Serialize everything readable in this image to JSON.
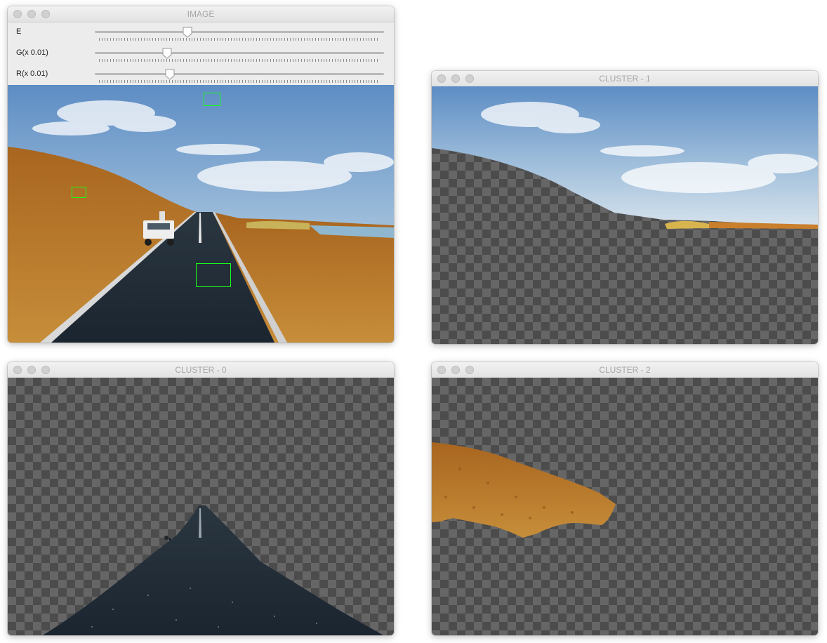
{
  "windows": {
    "image": {
      "title": "IMAGE",
      "trackbars": [
        {
          "label": "E",
          "value": 0.32
        },
        {
          "label": "G(x 0.01)",
          "value": 0.25
        },
        {
          "label": "R(x 0.01)",
          "value": 0.26
        }
      ]
    },
    "cluster1": {
      "title": "CLUSTER - 1"
    },
    "cluster0": {
      "title": "CLUSTER - 0"
    },
    "cluster2": {
      "title": "CLUSTER - 2"
    }
  },
  "colors": {
    "selection_box": "#1aff1a",
    "checker_dark": "#4c4c4c",
    "checker_light": "#666666"
  }
}
